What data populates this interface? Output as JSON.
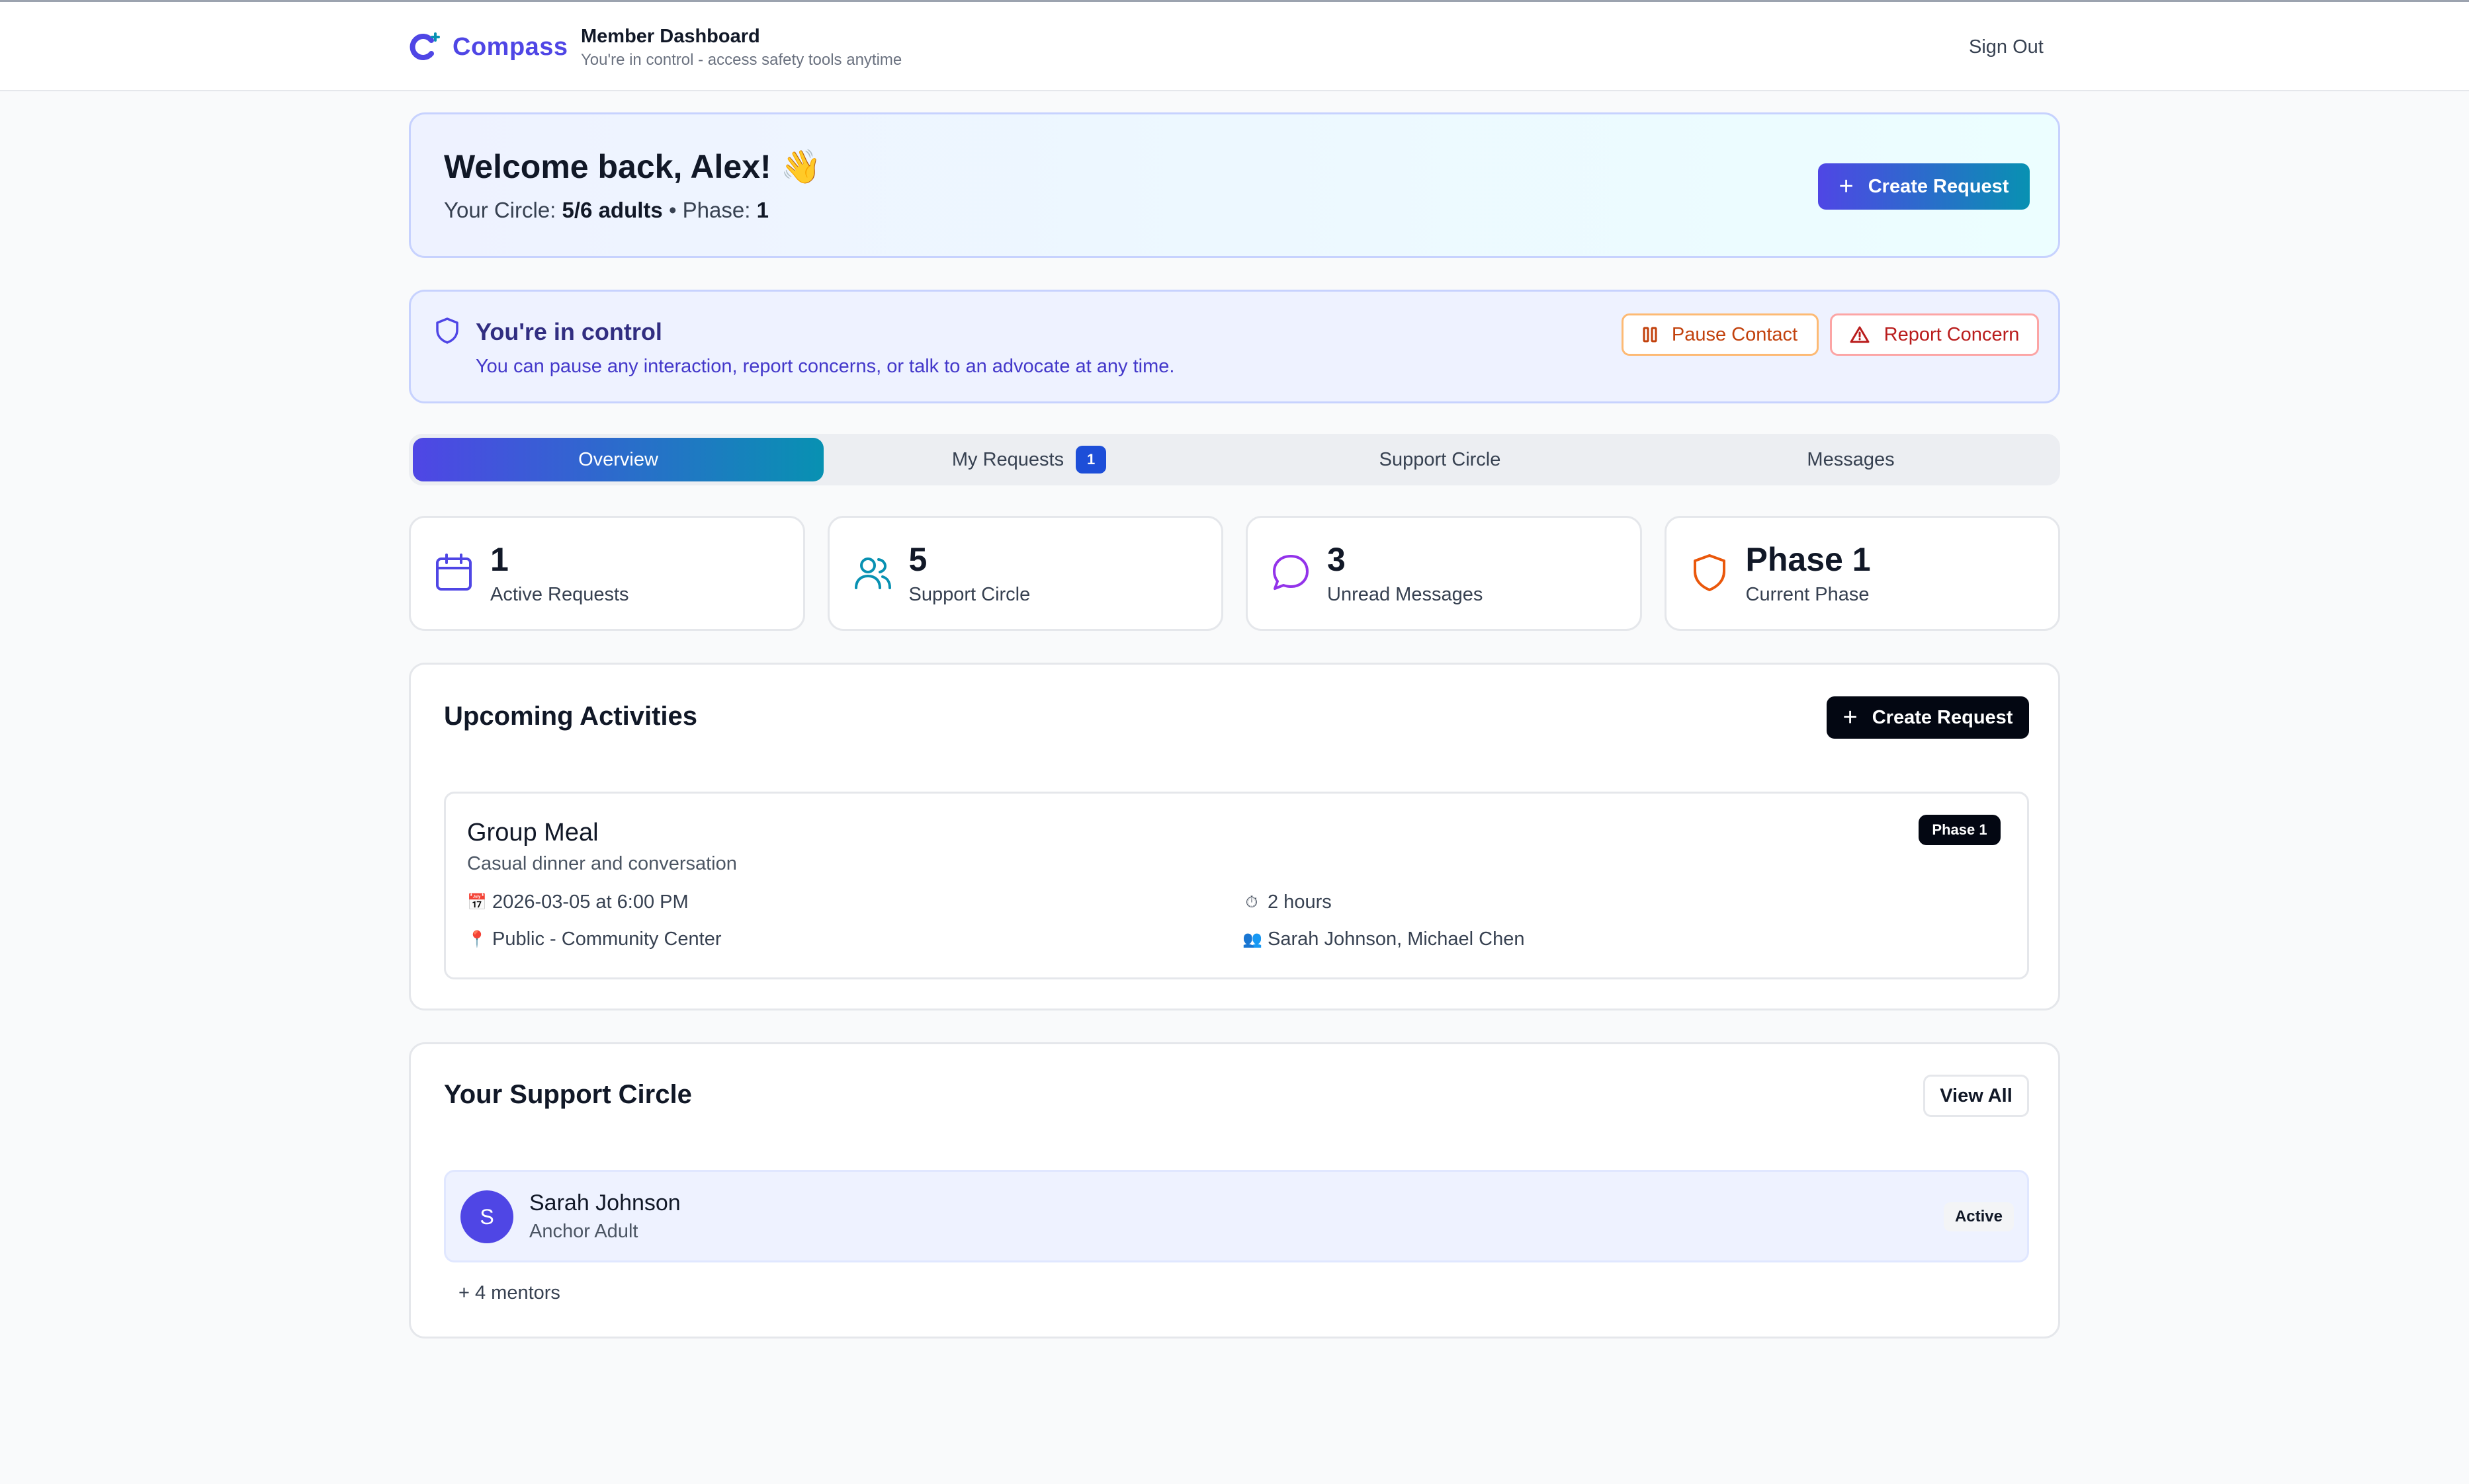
{
  "header": {
    "brand": "Compass",
    "title": "Member Dashboard",
    "subtitle": "You're in control - access safety tools anytime",
    "sign_out": "Sign Out"
  },
  "welcome": {
    "greeting": "Welcome back, Alex! 👋",
    "circle_label": "Your Circle:",
    "circle_value": "5/6 adults",
    "separator": "•",
    "phase_label": "Phase:",
    "phase_value": "1",
    "create_request": "Create Request"
  },
  "control": {
    "title": "You're in control",
    "text": "You can pause any interaction, report concerns, or talk to an advocate at any time.",
    "pause": "Pause Contact",
    "report": "Report Concern"
  },
  "tabs": [
    {
      "label": "Overview",
      "active": true
    },
    {
      "label": "My Requests",
      "badge": "1"
    },
    {
      "label": "Support Circle"
    },
    {
      "label": "Messages"
    }
  ],
  "stats": [
    {
      "value": "1",
      "label": "Active Requests",
      "icon": "calendar-icon",
      "color": "#4f46e5"
    },
    {
      "value": "5",
      "label": "Support Circle",
      "icon": "users-icon",
      "color": "#0891b2"
    },
    {
      "value": "3",
      "label": "Unread Messages",
      "icon": "message-icon",
      "color": "#9333ea"
    },
    {
      "value": "Phase 1",
      "label": "Current Phase",
      "icon": "shield-icon",
      "color": "#ea580c"
    }
  ],
  "activities": {
    "title": "Upcoming Activities",
    "create_request": "Create Request",
    "items": [
      {
        "title": "Group Meal",
        "description": "Casual dinner and conversation",
        "phase": "Phase 1",
        "date": "2026-03-05 at 6:00 PM",
        "duration": "2 hours",
        "location": "Public - Community Center",
        "attendees": "Sarah Johnson, Michael Chen"
      }
    ]
  },
  "support_circle": {
    "title": "Your Support Circle",
    "view_all": "View All",
    "members": [
      {
        "initial": "S",
        "name": "Sarah Johnson",
        "role": "Anchor Adult",
        "status": "Active"
      }
    ],
    "more": "+ 4 mentors"
  },
  "colors": {
    "brand": "#4f46e5",
    "accent": "#0891b2",
    "pause": "#c2410c",
    "report": "#b91c1c"
  }
}
